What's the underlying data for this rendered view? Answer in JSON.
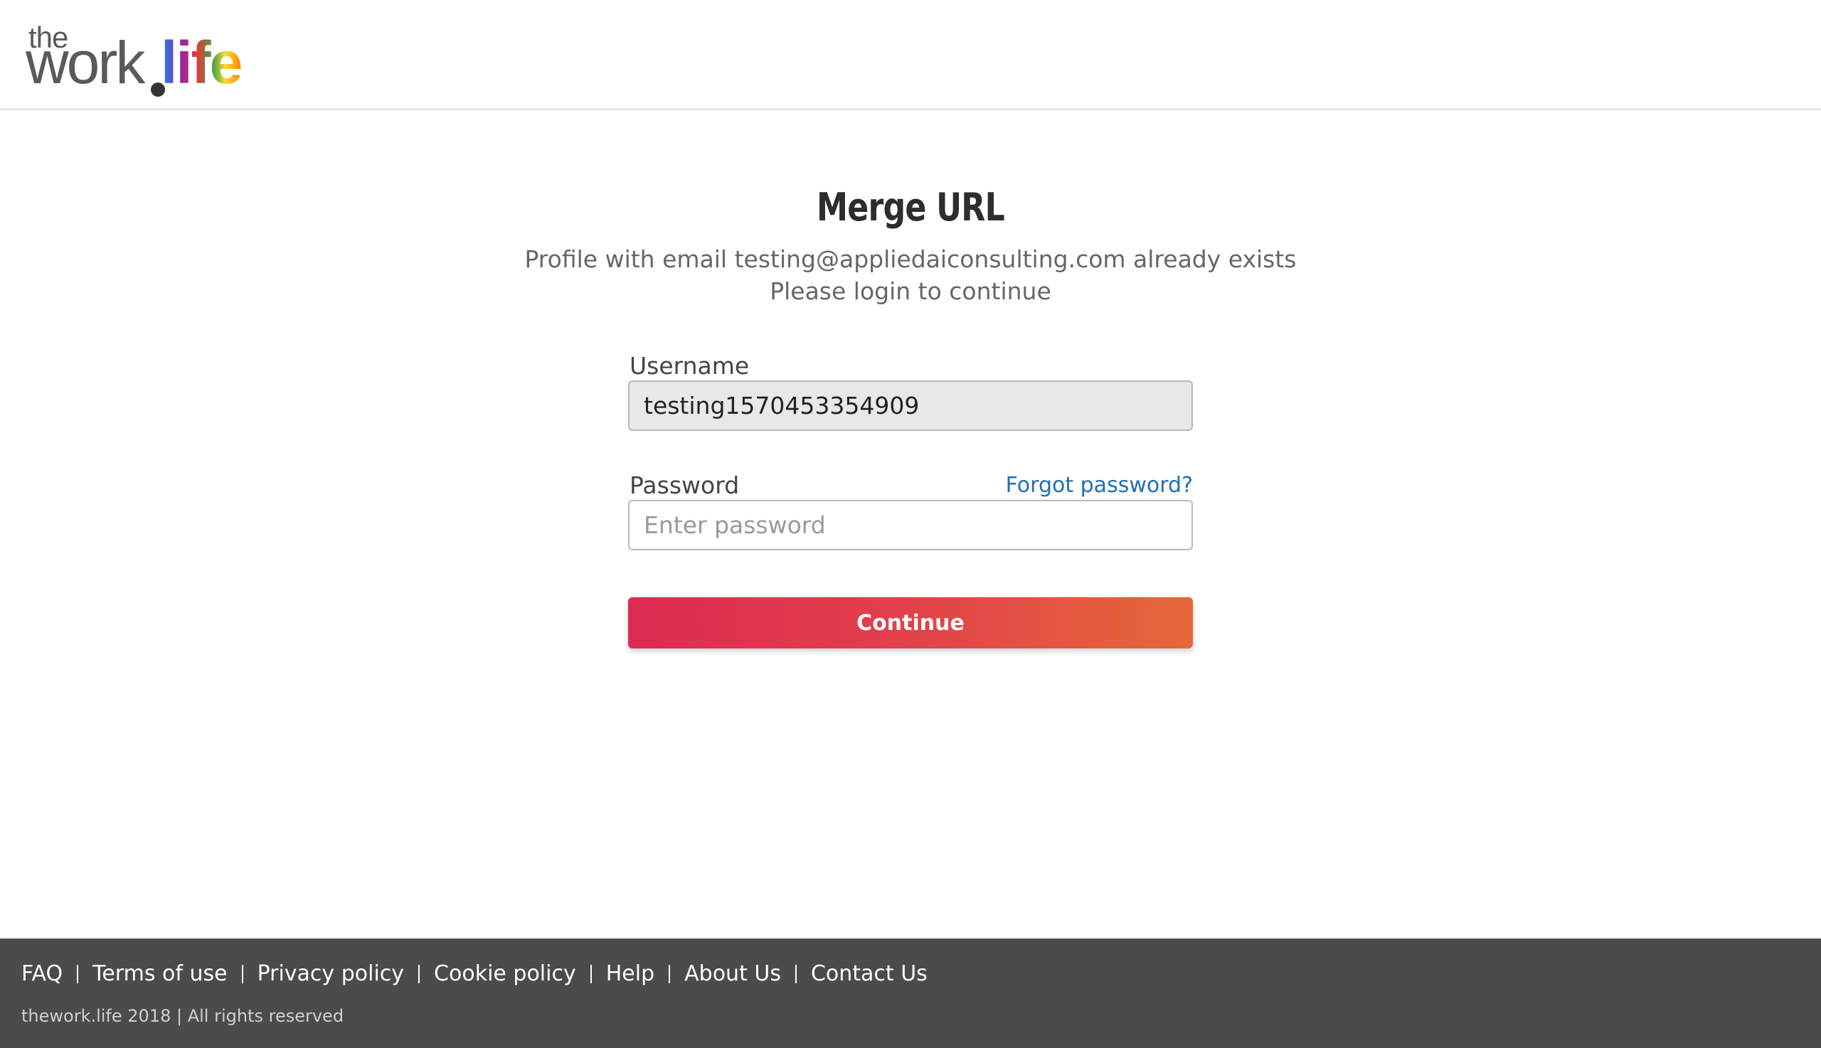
{
  "header": {
    "logo": {
      "the": "the",
      "work": "work",
      "life": "life"
    }
  },
  "main": {
    "title": "Merge URL",
    "subtitle_line1": "Profile with email testing@appliedaiconsulting.com already exists",
    "subtitle_line2": "Please login to continue"
  },
  "form": {
    "username_label": "Username",
    "username_value": "testing1570453354909",
    "password_label": "Password",
    "password_placeholder": "Enter password",
    "forgot_password": "Forgot password?",
    "continue_label": "Continue"
  },
  "footer": {
    "links": [
      "FAQ",
      "Terms of use",
      "Privacy policy",
      "Cookie policy",
      "Help",
      "About Us",
      "Contact Us"
    ],
    "copyright": "thework.life 2018 | All rights reserved"
  },
  "colors": {
    "footer_bg": "#4b4b4c",
    "link_blue": "#1f6fb2",
    "button_gradient_start": "#dc2b52",
    "button_gradient_end": "#e5683a"
  }
}
